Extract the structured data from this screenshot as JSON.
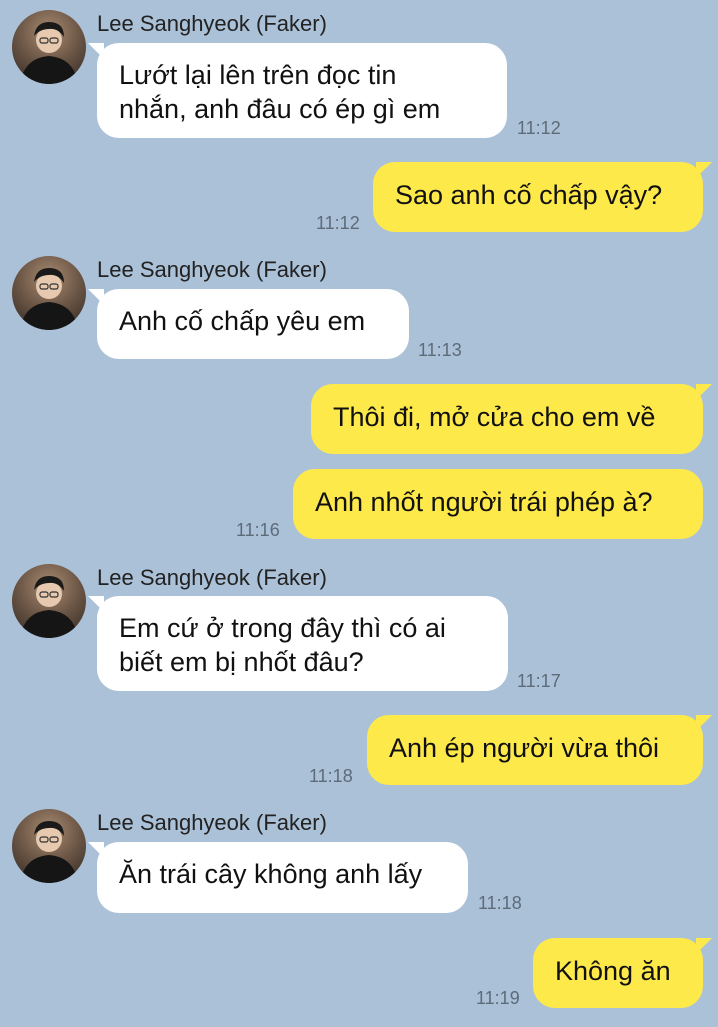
{
  "contact": {
    "name": "Lee Sanghyeok (Faker)"
  },
  "messages": [
    {
      "from": "in",
      "text_lines": [
        "Lướt lại lên trên đọc tin",
        "nhắn, anh đâu có ép gì em"
      ],
      "time": "11:12"
    },
    {
      "from": "out",
      "text": "Sao anh cố chấp vậy?",
      "time": "11:12"
    },
    {
      "from": "in",
      "text": "Anh cố chấp yêu em",
      "time": "11:13"
    },
    {
      "from": "out",
      "text": "Thôi đi, mở cửa cho em về"
    },
    {
      "from": "out",
      "text": "Anh nhốt người trái phép à?",
      "time": "11:16"
    },
    {
      "from": "in",
      "text_lines": [
        "Em cứ ở trong đây thì có ai",
        "biết em bị nhốt đâu?"
      ],
      "time": "11:17"
    },
    {
      "from": "out",
      "text": "Anh ép người vừa thôi",
      "time": "11:18"
    },
    {
      "from": "in",
      "text": "Ăn trái cây không anh lấy",
      "time": "11:18"
    },
    {
      "from": "out",
      "text": "Không ăn",
      "time": "11:19"
    }
  ],
  "colors": {
    "background": "#abc1d8",
    "incoming_bubble": "#ffffff",
    "outgoing_bubble": "#fee94a"
  }
}
